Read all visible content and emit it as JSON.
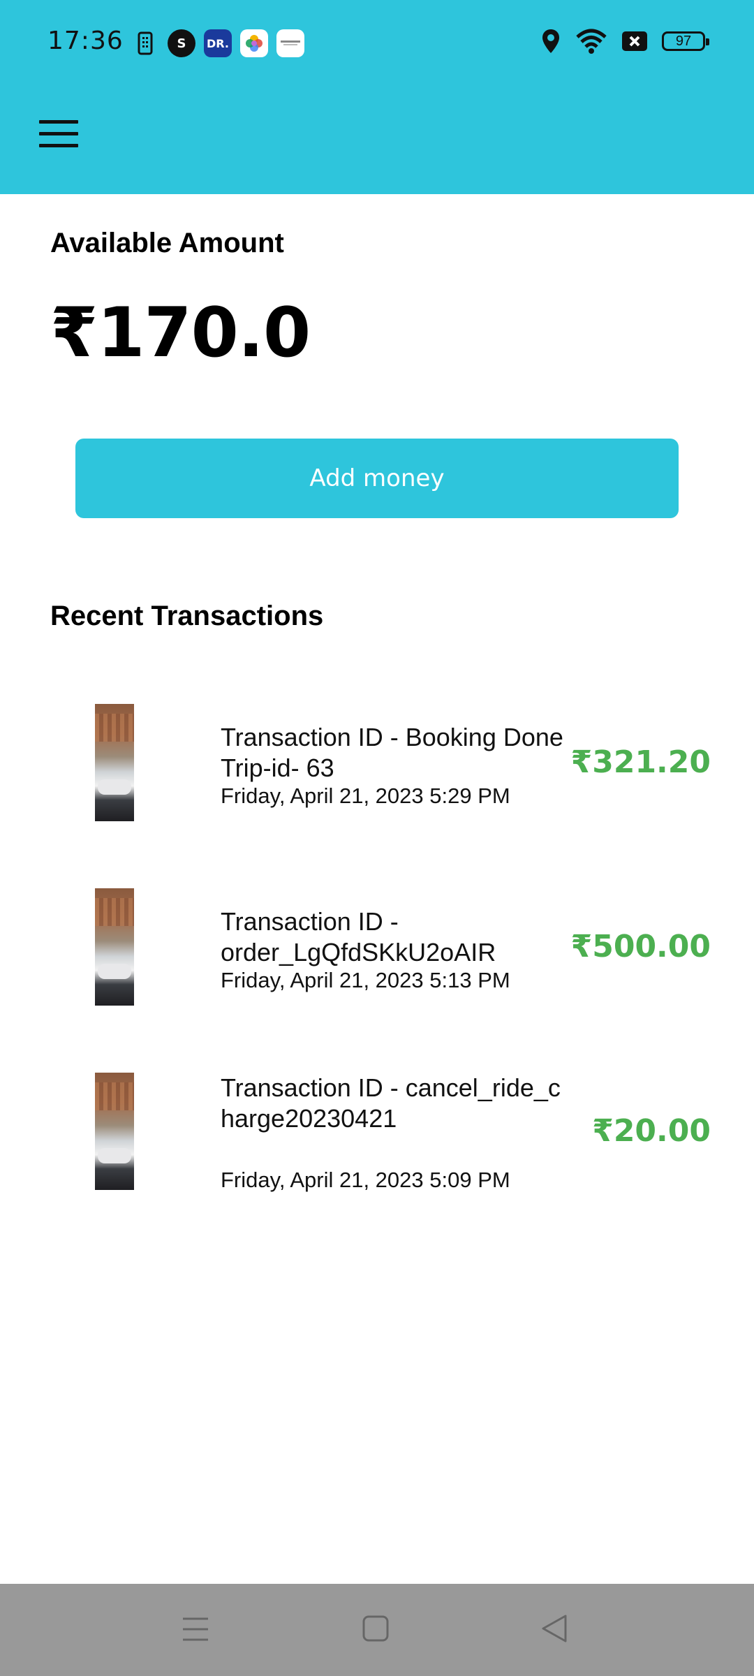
{
  "status_bar": {
    "time": "17:36",
    "notification_icons": [
      "sim-icon",
      "skype-icon",
      "dr-app-icon",
      "photos-icon",
      "app-icon"
    ],
    "dr_label": "DR.",
    "s_label": "S",
    "right_icons": [
      "location-icon",
      "wifi-icon",
      "no-signal-icon"
    ],
    "battery": "97"
  },
  "header": {
    "menu_icon": "hamburger-menu-icon",
    "color": "#2ec5dc"
  },
  "wallet": {
    "available_label": "Available Amount",
    "amount": "₹170.0",
    "add_money_label": "Add money"
  },
  "transactions": {
    "title": "Recent Transactions",
    "items": [
      {
        "title": "Transaction ID - Booking Done Trip-id- 63",
        "date": "Friday, April 21, 2023 5:29 PM",
        "amount": "₹321.20"
      },
      {
        "title": "Transaction ID - order_LgQfdSKkU2oAIR",
        "date": "Friday, April 21, 2023 5:13 PM",
        "amount": "₹500.00"
      },
      {
        "title": "Transaction ID - cancel_ride_charge20230421",
        "date": "Friday, April 21, 2023 5:09 PM",
        "amount": "₹20.00"
      }
    ],
    "amount_color": "#4caf50"
  },
  "nav_bar": {
    "buttons": [
      "recents-icon",
      "home-icon",
      "back-icon"
    ]
  }
}
